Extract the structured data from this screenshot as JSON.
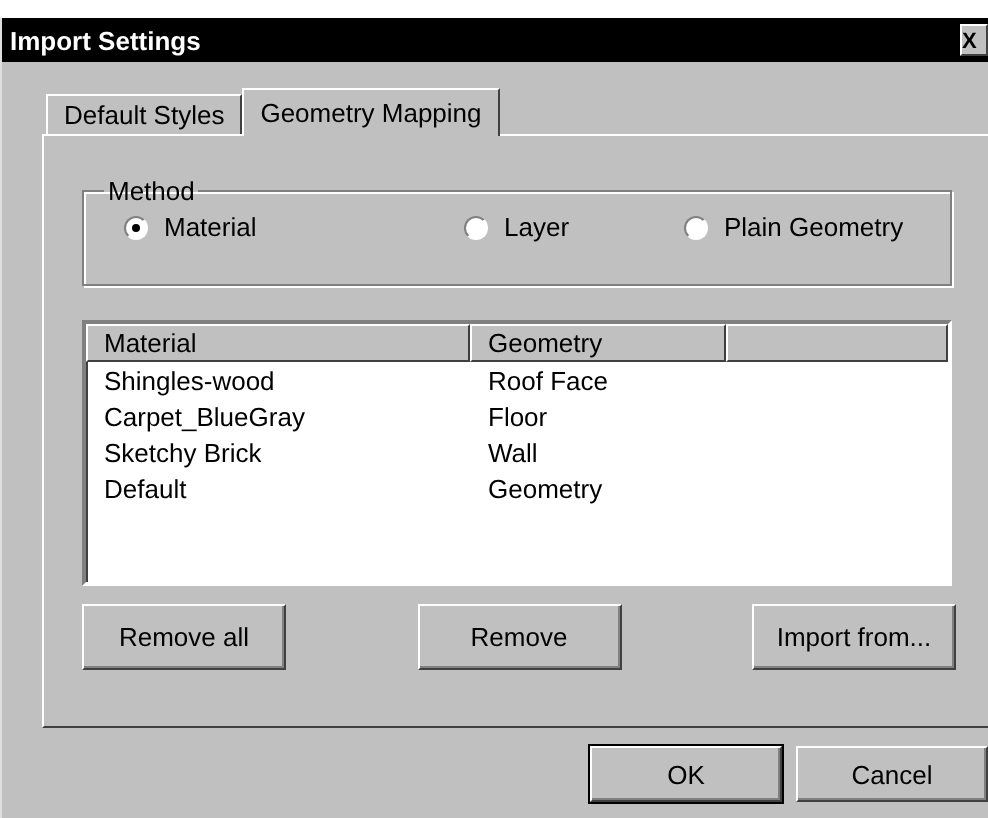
{
  "window": {
    "title": "Import Settings",
    "close": "X"
  },
  "tabs": [
    {
      "label": "Default Styles",
      "selected": false
    },
    {
      "label": "Geometry Mapping",
      "selected": true
    }
  ],
  "method": {
    "label": "Method",
    "options": [
      {
        "label": "Material",
        "selected": true
      },
      {
        "label": "Layer",
        "selected": false
      },
      {
        "label": "Plain Geometry",
        "selected": false
      }
    ]
  },
  "table": {
    "columns": [
      "Material",
      "Geometry"
    ],
    "rows": [
      [
        "Shingles-wood",
        "Roof Face"
      ],
      [
        "Carpet_BlueGray",
        "Floor"
      ],
      [
        "Sketchy Brick",
        "Wall"
      ],
      [
        "Default",
        "Geometry"
      ]
    ]
  },
  "buttons": [
    "Remove all",
    "Remove",
    "Import from..."
  ],
  "dialog_buttons": [
    {
      "label": "OK",
      "default": true
    },
    {
      "label": "Cancel",
      "default": false
    }
  ]
}
